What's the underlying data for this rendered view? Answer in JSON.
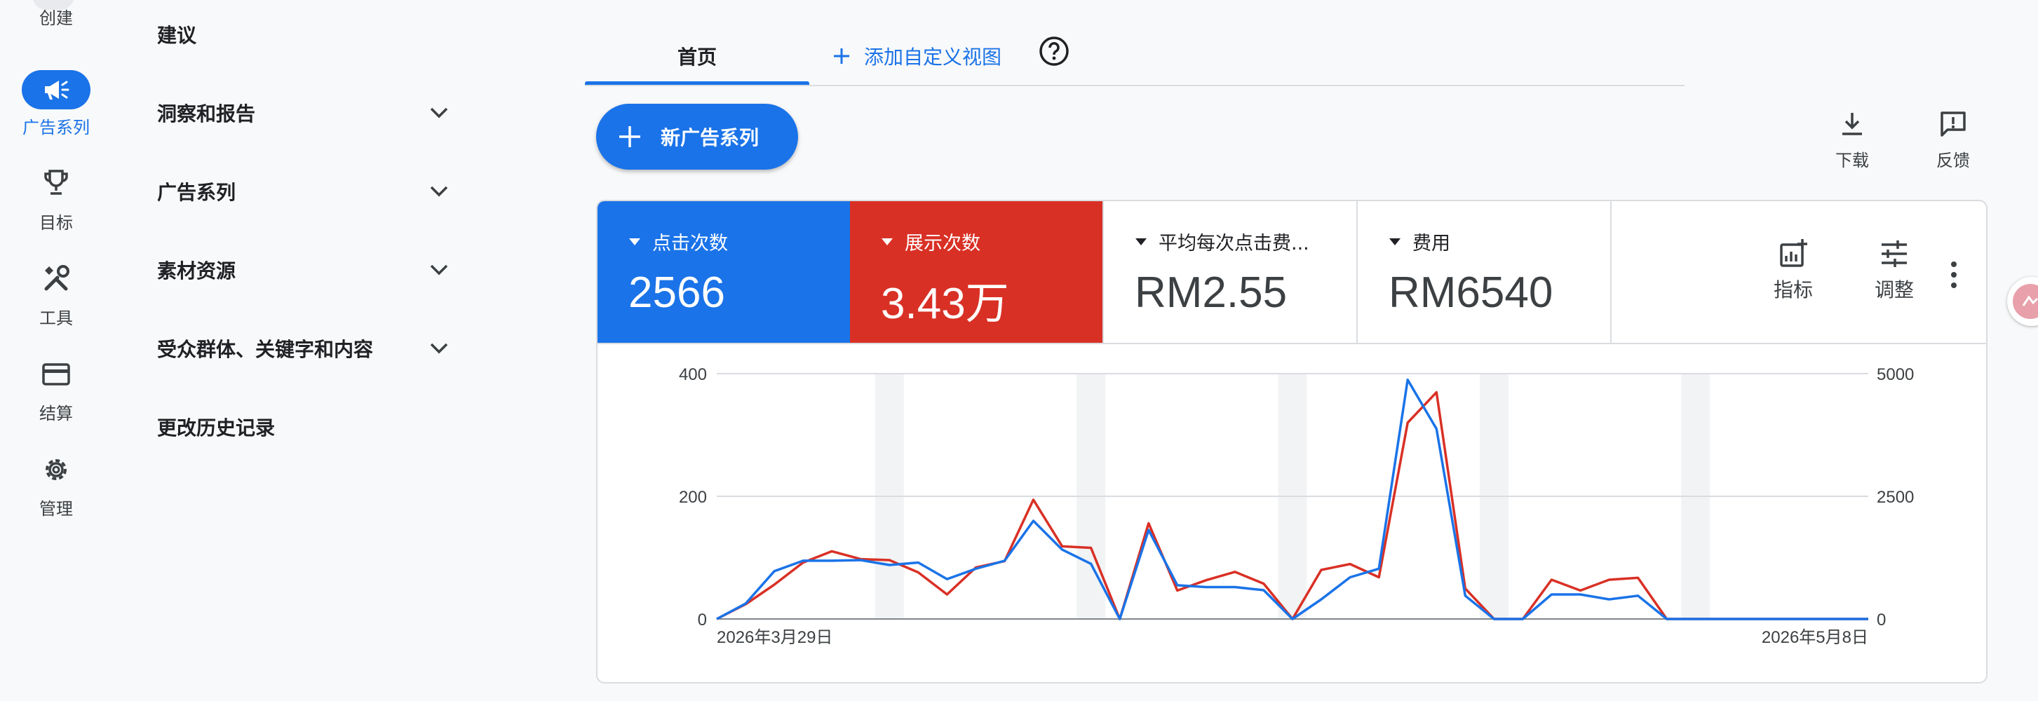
{
  "rail": {
    "create_label": "创建",
    "items": [
      {
        "label": "广告系列",
        "icon": "campaign-megaphone-icon",
        "active": true
      },
      {
        "label": "目标",
        "icon": "trophy-icon"
      },
      {
        "label": "工具",
        "icon": "tools-icon"
      },
      {
        "label": "结算",
        "icon": "credit-card-icon"
      },
      {
        "label": "管理",
        "icon": "gear-icon"
      }
    ]
  },
  "nav": {
    "items": [
      {
        "label": "建议"
      },
      {
        "label": "洞察和报告",
        "expandable": true
      },
      {
        "label": "广告系列",
        "expandable": true
      },
      {
        "label": "素材资源",
        "expandable": true
      },
      {
        "label": "受众群体、关键字和内容",
        "expandable": true
      },
      {
        "label": "更改历史记录"
      }
    ]
  },
  "tabs": {
    "home": "首页",
    "add_view": "添加自定义视图"
  },
  "toolbar": {
    "new_campaign": "新广告系列",
    "download": "下载",
    "feedback": "反馈"
  },
  "metrics": [
    {
      "label": "点击次数",
      "value": "2566",
      "color": "#1a73e8"
    },
    {
      "label": "展示次数",
      "value": "3.43万",
      "color": "#d93025"
    },
    {
      "label": "平均每次点击费...",
      "value": "RM2.55"
    },
    {
      "label": "费用",
      "value": "RM6540"
    }
  ],
  "card_actions": {
    "metrics": "指标",
    "adjust": "调整"
  },
  "colors": {
    "accent": "#1a73e8",
    "clicks": "#1a73e8",
    "impressions": "#d93025"
  },
  "chart_data": {
    "type": "line",
    "x_start_label": "2026年3月29日",
    "x_end_label": "2026年5月8日",
    "left_axis": {
      "ticks": [
        "400",
        "200",
        "0"
      ],
      "ylim": [
        0,
        400
      ]
    },
    "right_axis": {
      "ticks": [
        "5000",
        "2500",
        "0"
      ],
      "ylim": [
        0,
        5000
      ]
    },
    "series": [
      {
        "axis": "left",
        "color": "#1a73e8",
        "values": [
          0,
          25,
          78,
          95,
          95,
          96,
          88,
          92,
          65,
          82,
          95,
          160,
          113,
          90,
          0,
          145,
          55,
          52,
          52,
          47,
          0,
          32,
          68,
          82,
          390,
          310,
          38,
          0,
          0,
          40,
          40,
          32,
          38,
          0,
          0,
          0,
          0,
          0,
          0,
          0,
          0
        ]
      },
      {
        "axis": "right",
        "color": "#d93025",
        "values": [
          0,
          300,
          700,
          1150,
          1380,
          1220,
          1200,
          950,
          500,
          1050,
          1180,
          2430,
          1480,
          1450,
          0,
          1950,
          580,
          790,
          960,
          720,
          0,
          1000,
          1120,
          850,
          4000,
          4620,
          620,
          0,
          0,
          800,
          580,
          800,
          840,
          0,
          0,
          0,
          0,
          0,
          0,
          0,
          0
        ]
      }
    ],
    "shaded_band_indices": [
      6,
      13,
      20,
      27,
      34
    ]
  }
}
